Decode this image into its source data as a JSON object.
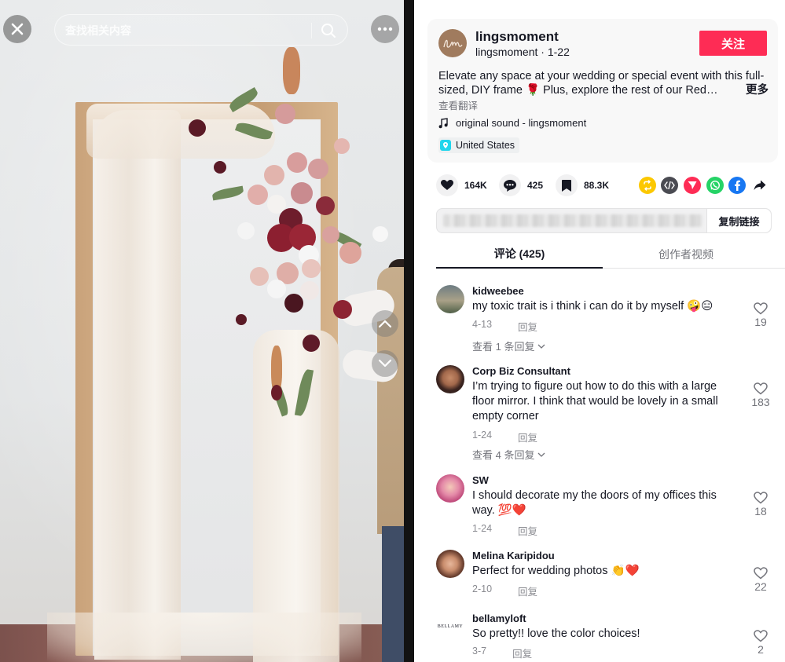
{
  "video": {
    "search_placeholder": "查找相关内容"
  },
  "author": {
    "name": "lingsmoment",
    "handle": "lingsmoment",
    "date": "1-22",
    "avatar_text": "lm",
    "follow_label": "关注"
  },
  "description": {
    "text": "Elevate any space at your wedding or special event with this full-sized, DIY frame 🌹 Plus, explore the rest of our Red…",
    "more_label": "更多",
    "translate_label": "查看翻译",
    "music": "original sound - lingsmoment",
    "location": "United States"
  },
  "stats": {
    "likes": "164K",
    "comments": "425",
    "saves": "88.3K"
  },
  "link_bar": {
    "copy_label": "复制链接"
  },
  "tabs": {
    "comments_label": "评论 (425)",
    "creator_videos_label": "创作者视频"
  },
  "comments": [
    {
      "user": "kidweebee",
      "text": "my toxic trait is i think i can do it by myself 🤪😑",
      "date": "4-13",
      "reply_label": "回复",
      "likes": "19",
      "view_replies": "查看 1 条回复"
    },
    {
      "user": "Corp Biz Consultant",
      "text": "I’m trying to figure out how to do this with a large floor mirror. I think that would be lovely in a small empty corner",
      "date": "1-24",
      "reply_label": "回复",
      "likes": "183",
      "view_replies": "查看 4 条回复"
    },
    {
      "user": "SW",
      "text": "I should decorate my the doors of my offices this way. 💯❤️",
      "date": "1-24",
      "reply_label": "回复",
      "likes": "18"
    },
    {
      "user": "Melina Karipidou",
      "text": "Perfect for wedding photos 👏❤️",
      "date": "2-10",
      "reply_label": "回复",
      "likes": "22"
    },
    {
      "user": "bellamyloft",
      "text": "So pretty!! love the color choices!",
      "date": "3-7",
      "reply_label": "回复",
      "likes": "2",
      "avatar_text": "BELLAMY"
    }
  ],
  "colors": {
    "accent": "#fe2c55",
    "text_primary": "#161823",
    "text_secondary": "#73747b"
  }
}
